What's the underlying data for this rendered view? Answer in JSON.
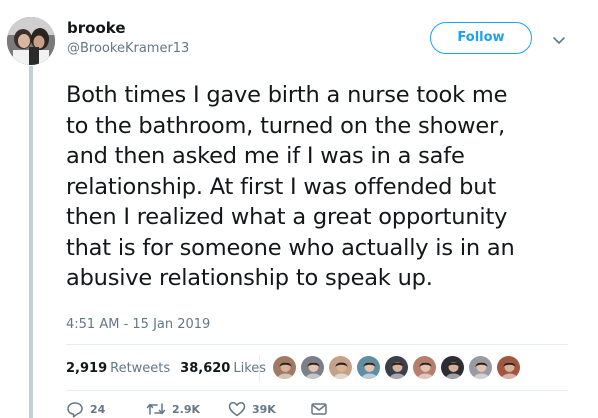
{
  "author": {
    "name": "brooke",
    "handle": "@BrookeKramer13"
  },
  "follow_button": {
    "label": "Follow"
  },
  "tweet": {
    "text": "Both times I gave birth a nurse took me\nto the bathroom, turned on the shower,\nand then asked me if I was in a safe\nrelationship. At first I was offended but\nthen I realized what a great opportunity\nthat is for someone who actually is in an\nabusive relationship to speak up.",
    "timestamp": "4:51 AM - 15 Jan 2019"
  },
  "stats": {
    "retweets_count": "2,919",
    "retweets_label": "Retweets",
    "likes_count": "38,620",
    "likes_label": "Likes"
  },
  "liked_by_avatars": [
    {
      "icon": "user-avatar",
      "color": "#a07a62"
    },
    {
      "icon": "user-avatar",
      "color": "#7d7f88"
    },
    {
      "icon": "user-avatar",
      "color": "#c4a28a"
    },
    {
      "icon": "user-avatar",
      "color": "#5f8ea3"
    },
    {
      "icon": "user-avatar",
      "color": "#3b3f4a"
    },
    {
      "icon": "user-avatar",
      "color": "#b57f6d"
    },
    {
      "icon": "user-avatar",
      "color": "#2d2d35"
    },
    {
      "icon": "user-avatar",
      "color": "#9a9aa2"
    },
    {
      "icon": "user-avatar",
      "color": "#a0563f"
    }
  ],
  "actions": {
    "reply_count": "24",
    "retweet_count": "2.9K",
    "like_count": "39K"
  },
  "colors": {
    "accent": "#1da1f2",
    "text": "#14171a",
    "muted": "#657786",
    "thread_line": "#c4cfd8"
  }
}
